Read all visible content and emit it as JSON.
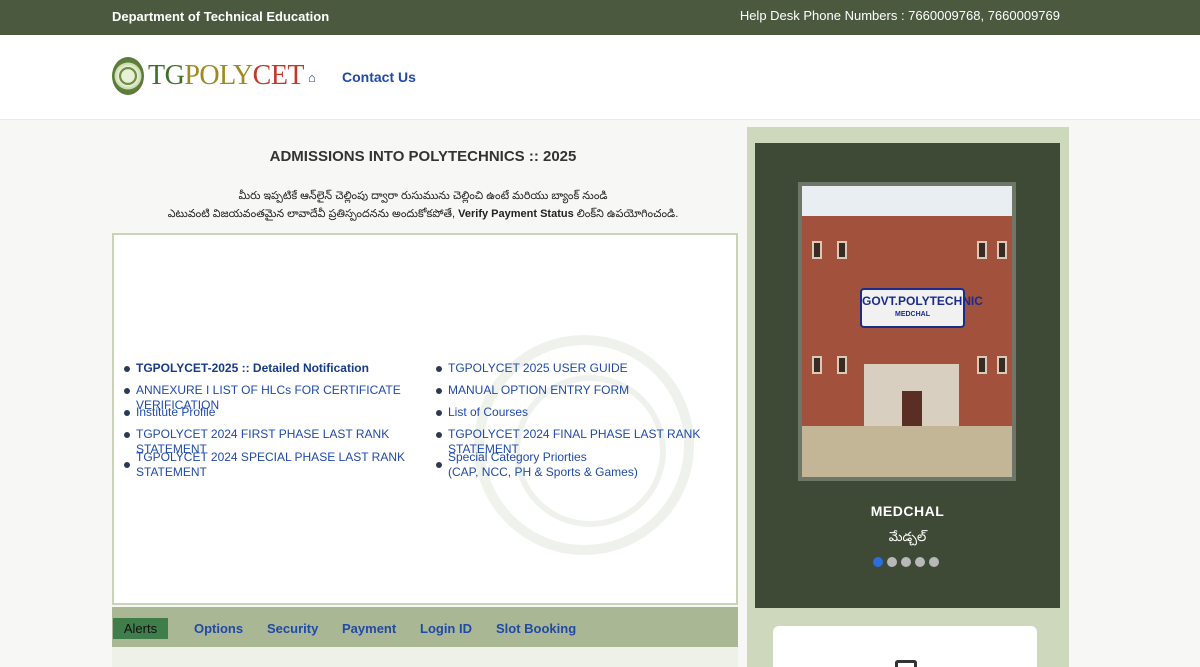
{
  "topbar": {
    "department": "Department of Technical Education",
    "helpdesk": "Help Desk Phone Numbers : 7660009768, 7660009769"
  },
  "header": {
    "logo": {
      "tg": "TG",
      "mid": "POLY",
      "end": "CET"
    },
    "home_icon": "home-icon",
    "contact": "Contact Us"
  },
  "main": {
    "title": "ADMISSIONS INTO POLYTECHNICS :: 2025",
    "notice_line1": "మీరు ఇప్పటికే ఆన్‌లైన్ చెల్లింపు ద్వారా రుసుమును చెల్లించి ఉంటే మరియు బ్యాంక్ నుండి",
    "notice_line2_pre": "ఎటువంటి విజయవంతమైన లావాదేవీ ప్రతిస్పందనను అందుకోకపోతే,",
    "notice_bold": "Verify Payment Status",
    "notice_line2_post": "లింక్‌ని ఉపయోగించండి."
  },
  "links_left": [
    {
      "label": "TGPOLYCET-2025 :: Detailed Notification"
    },
    {
      "label": "ANNEXURE I LIST OF HLCs FOR CERTIFICATE VERIFICATION"
    },
    {
      "label": "Institute Profile"
    },
    {
      "label": "TGPOLYCET 2024 FIRST PHASE LAST RANK STATEMENT"
    },
    {
      "label": "TGPOLYCET 2024 SPECIAL PHASE LAST RANK STATEMENT"
    }
  ],
  "links_right": [
    {
      "label": "TGPOLYCET 2025 USER GUIDE"
    },
    {
      "label": "MANUAL OPTION ENTRY FORM"
    },
    {
      "label": "List of Courses"
    },
    {
      "label": "TGPOLYCET 2024 FINAL PHASE LAST RANK STATEMENT"
    },
    {
      "label": "Special Category Priorties",
      "label2": "(CAP, NCC, PH & Sports & Games)"
    }
  ],
  "tabs": [
    "Alerts",
    "Options",
    "Security",
    "Payment",
    "Login ID",
    "Slot Booking"
  ],
  "slider": {
    "sign_main": "GOVT.POLYTECHNIC",
    "sign_sub": "MEDCHAL",
    "caption": "MEDCHAL",
    "caption_telugu": "మేడ్చల్",
    "slide_count": 5,
    "active_slide": 1
  },
  "colors": {
    "topbar": "#4b5a3f",
    "link": "#1f4aa8",
    "tabbar": "#a9b794",
    "active_tab": "#3f7d4a",
    "slider_bg": "#3e4a36",
    "active_dot": "#2a6fe0"
  }
}
